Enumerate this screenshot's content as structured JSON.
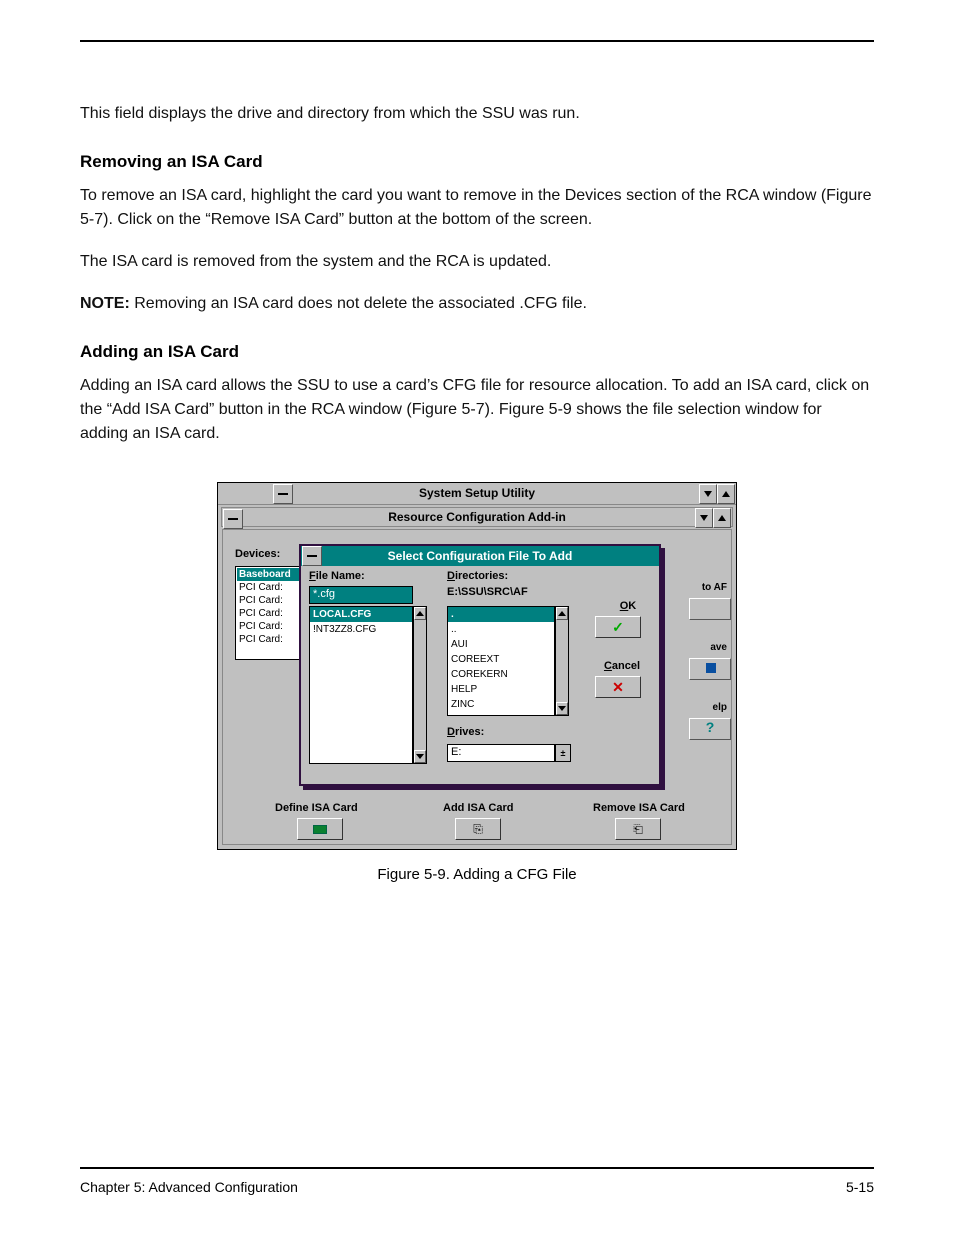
{
  "page": {
    "intro": "This field displays the drive and directory from which the SSU was run.",
    "sectionHeading": "Removing an ISA Card",
    "removingText1": "To remove an ISA card, highlight the card you want to remove in the Devices section of the RCA window (Figure 5-7). Click on the “Remove ISA Card” button at the bottom of the screen.",
    "removingText2": "The ISA card is removed from the system and the RCA is updated.",
    "noteLabel": "NOTE:",
    "noteText": "Removing an ISA card does not delete the associated .CFG file.",
    "addingHeading": "Adding an ISA Card",
    "addingText": "Adding an ISA card allows the SSU to use a card’s CFG file for resource allocation. To add an ISA card, click on the “Add ISA Card” button in the RCA window (Figure 5-7). Figure 5-9 shows the file selection window for adding an ISA card.",
    "figCaption": "Figure 5-9.  Adding a CFG File",
    "chapterRef": "Chapter 5: Advanced Configuration",
    "pageNumber": "5-15"
  },
  "shot": {
    "outerTitle": "System Setup Utility",
    "innerTitle": "Resource Configuration Add-in",
    "devicesLabel": "Devices:",
    "devices": [
      "Baseboard",
      "PCI Card:",
      "PCI Card:",
      "PCI Card:",
      "PCI Card:",
      "PCI Card:"
    ],
    "sideToAF": "to AF",
    "sideSave": "ave",
    "sideHelp": "elp",
    "bottom": {
      "define": "Define ISA Card",
      "add": "Add ISA Card",
      "remove": "Remove ISA Card"
    },
    "dialog": {
      "title": "Select Configuration File To Add",
      "fileNameLabel": "File Name:",
      "fileNameValue": "*.cfg",
      "files": [
        "LOCAL.CFG",
        "!NT3ZZ8.CFG"
      ],
      "directoriesLabel": "Directories:",
      "directoriesPath": "E:\\SSU\\SRC\\AF",
      "dirs": [
        ".",
        "..",
        "AUI",
        "COREEXT",
        "COREKERN",
        "HELP",
        "ZINC"
      ],
      "drivesLabel": "Drives:",
      "drivesValue": "E:",
      "ok": "OK",
      "cancel": "Cancel"
    }
  }
}
